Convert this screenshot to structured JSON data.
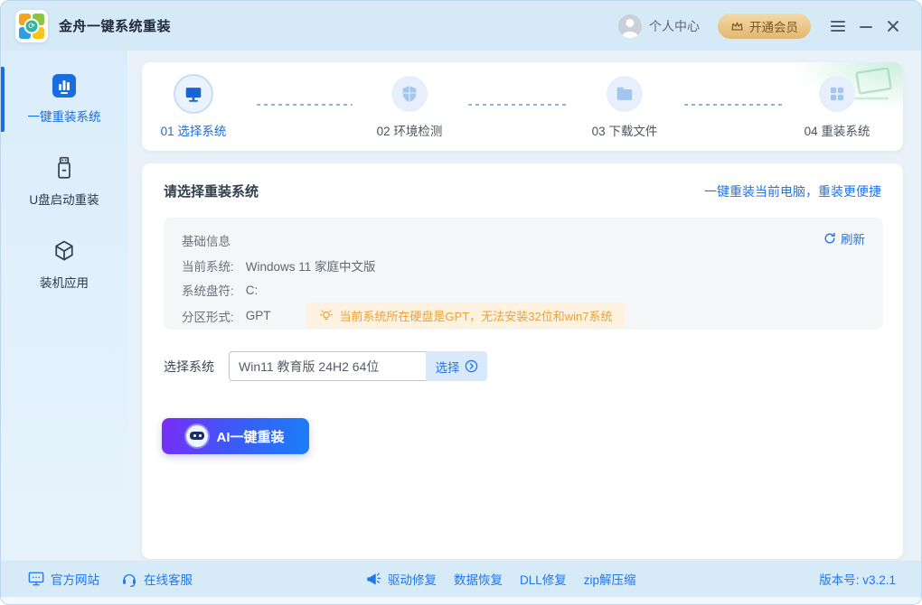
{
  "window": {
    "title": "金舟一键系统重装"
  },
  "titlebar": {
    "user_center": "个人中心",
    "vip_label": "开通会员"
  },
  "sidebar": {
    "items": [
      {
        "label": "一键重装系统",
        "icon": "bar-chart-tile-icon",
        "active": true
      },
      {
        "label": "U盘启动重装",
        "icon": "usb-drive-icon",
        "active": false
      },
      {
        "label": "装机应用",
        "icon": "cube-icon",
        "active": false
      }
    ]
  },
  "steps": {
    "items": [
      {
        "num": "01",
        "label": "选择系统",
        "icon": "monitor-icon",
        "active": true
      },
      {
        "num": "02",
        "label": "环境检测",
        "icon": "shield-icon",
        "active": false
      },
      {
        "num": "03",
        "label": "下载文件",
        "icon": "folder-icon",
        "active": false
      },
      {
        "num": "04",
        "label": "重装系统",
        "icon": "grid-icon",
        "active": false
      }
    ]
  },
  "main": {
    "title": "请选择重装系统",
    "subtitle": "一键重装当前电脑，重装更便捷",
    "info": {
      "title": "基础信息",
      "refresh_label": "刷新",
      "rows": [
        {
          "label": "当前系统:",
          "value": "Windows 11 家庭中文版"
        },
        {
          "label": "系统盘符:",
          "value": "C:"
        },
        {
          "label": "分区形式:",
          "value": "GPT"
        }
      ],
      "warning": "当前系统所在硬盘是GPT，无法安装32位和win7系统"
    },
    "select": {
      "label": "选择系统",
      "value": "Win11 教育版 24H2 64位",
      "button_label": "选择"
    },
    "ai_button_label": "AI一键重装"
  },
  "footer": {
    "left_links": [
      {
        "label": "官方网站",
        "icon": "monitor-outline-icon"
      },
      {
        "label": "在线客服",
        "icon": "headset-icon"
      }
    ],
    "tool_links": [
      {
        "label": "驱动修复",
        "icon": "megaphone-icon"
      },
      {
        "label": "数据恢复"
      },
      {
        "label": "DLL修复"
      },
      {
        "label": "zip解压缩"
      }
    ],
    "version": "版本号: v3.2.1"
  },
  "colors": {
    "accent_blue": "#1a6dde",
    "link_blue": "#2176e8",
    "warning_text": "#e9a23b",
    "warning_bg": "#fcf2df",
    "vip_bg_start": "#f5d9a8",
    "vip_bg_end": "#e2b671",
    "vip_text": "#7d5722",
    "ai_gradient_start": "#7a2cf5",
    "ai_gradient_end": "#1b7ef8"
  }
}
